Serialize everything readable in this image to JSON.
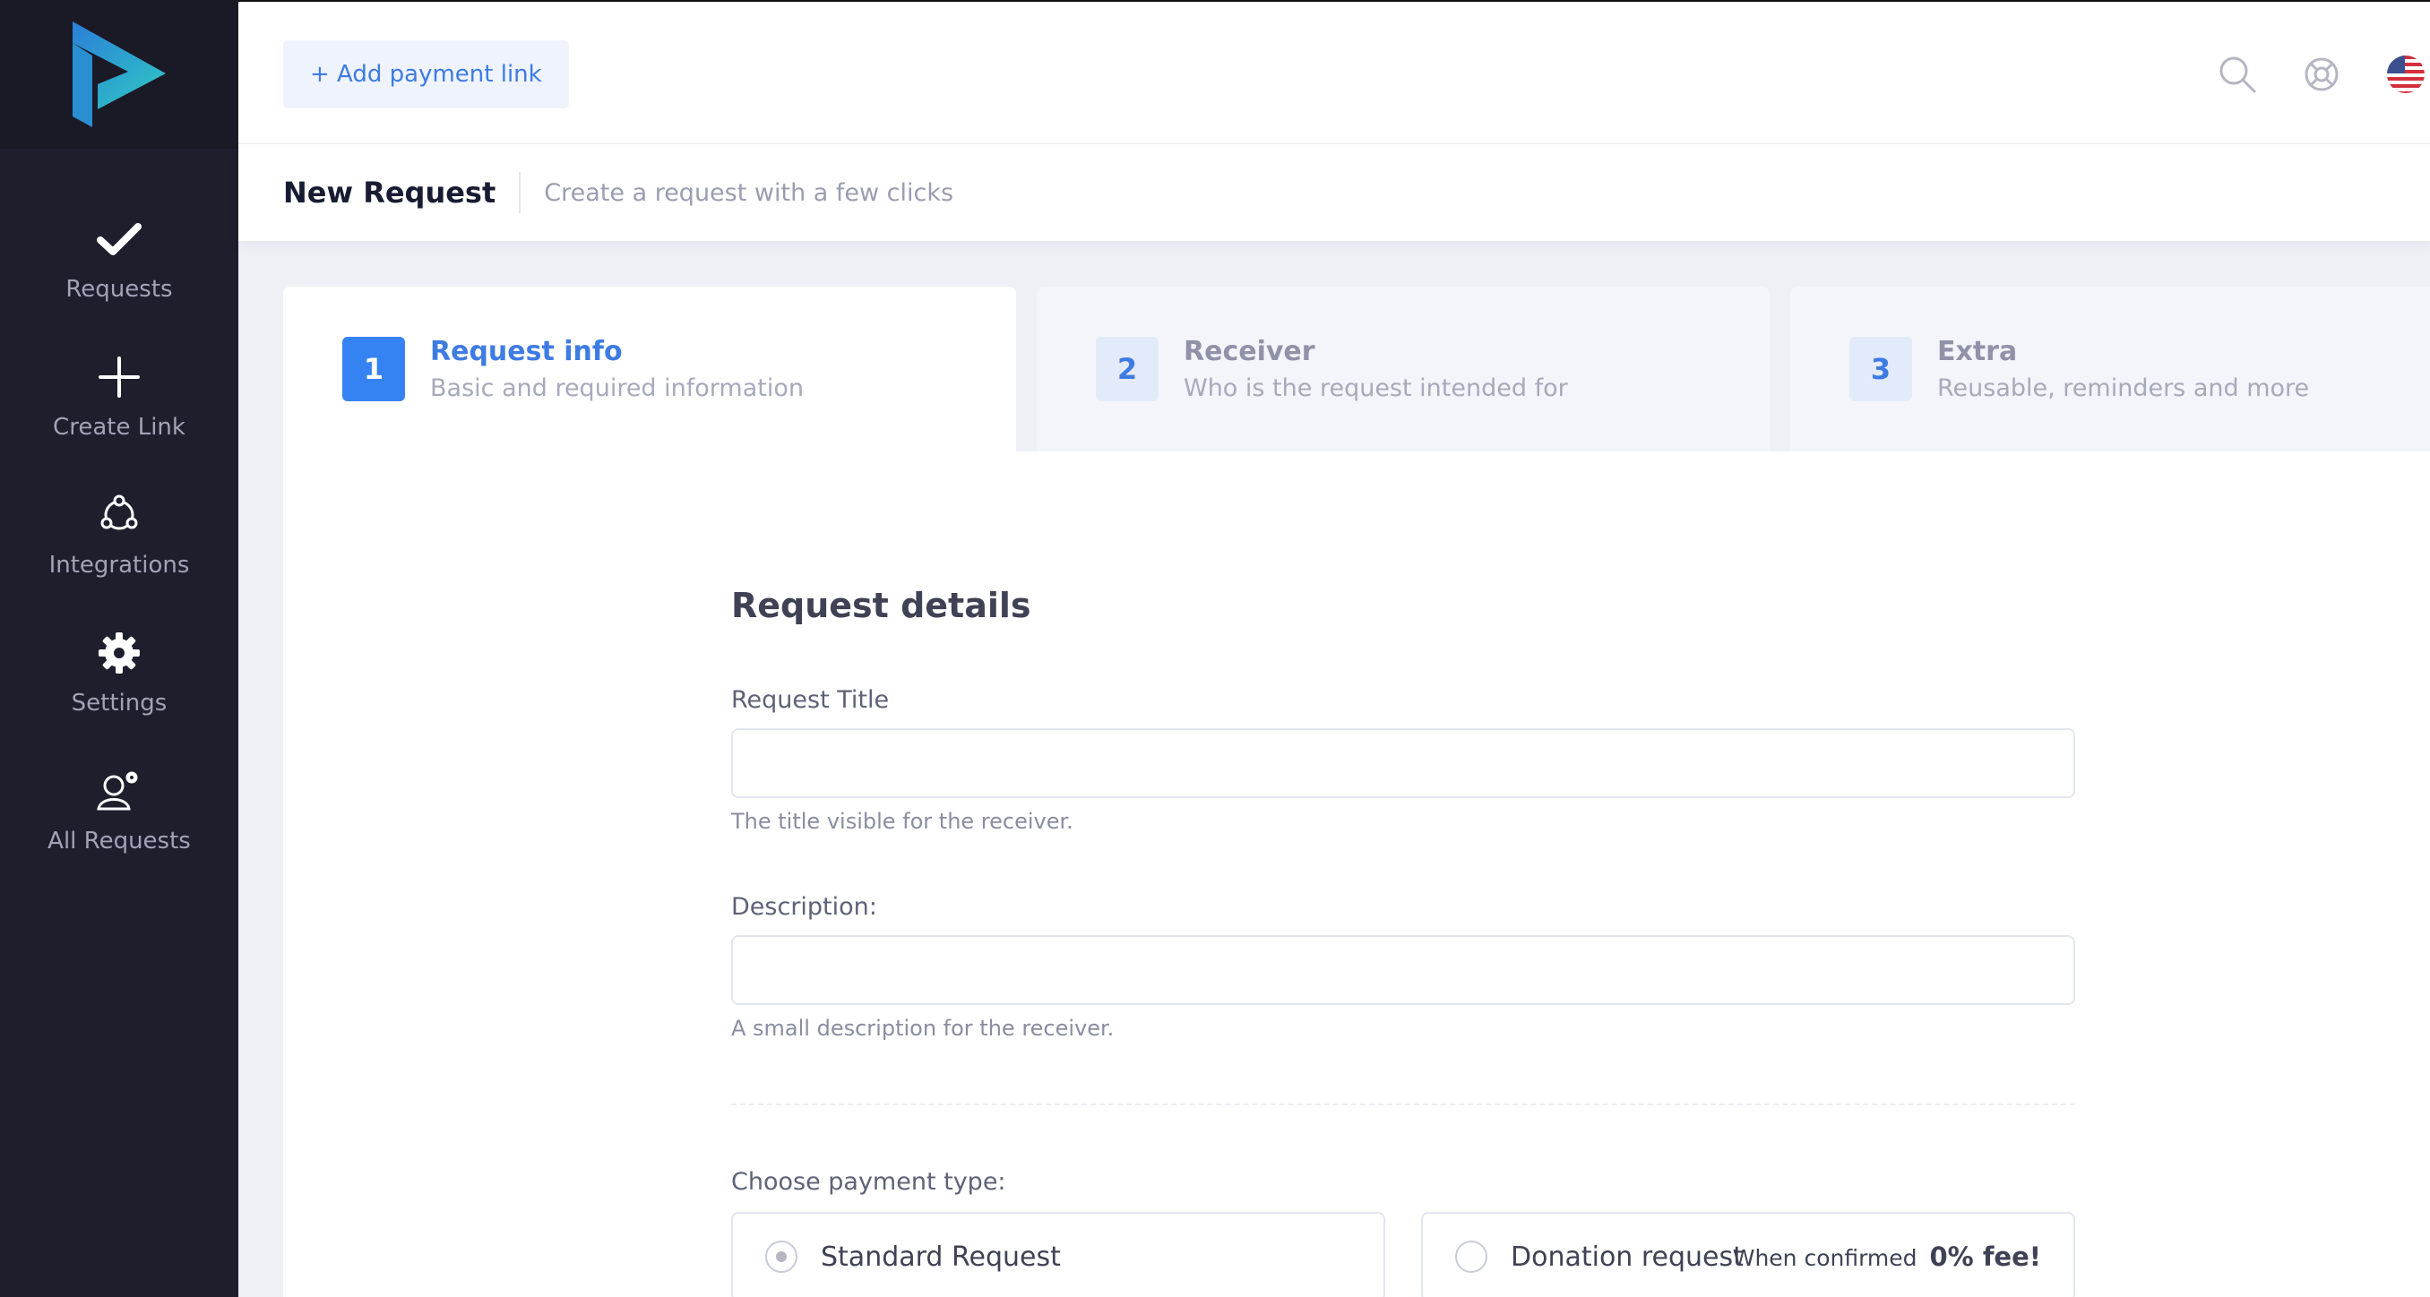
{
  "sidebar": {
    "logo_icon": "brand-logo-icon",
    "items": [
      {
        "label": "Requests",
        "icon": "check-icon"
      },
      {
        "label": "Create Link",
        "icon": "plus-icon"
      },
      {
        "label": "Integrations",
        "icon": "network-icon"
      },
      {
        "label": "Settings",
        "icon": "gear-icon"
      },
      {
        "label": "All Requests",
        "icon": "user-settings-icon"
      }
    ]
  },
  "topbar": {
    "add_button_label": "+ Add payment link",
    "icons": [
      "search-icon",
      "help-lifebuoy-icon",
      "us-flag-icon"
    ]
  },
  "subheader": {
    "title": "New Request",
    "description": "Create a request with a few clicks"
  },
  "wizard": {
    "steps": [
      {
        "number": "1",
        "title": "Request info",
        "subtitle": "Basic and required information",
        "active": true
      },
      {
        "number": "2",
        "title": "Receiver",
        "subtitle": "Who is the request intended for",
        "active": false
      },
      {
        "number": "3",
        "title": "Extra",
        "subtitle": "Reusable, reminders and more",
        "active": false
      }
    ]
  },
  "form": {
    "section_title": "Request details",
    "request_title": {
      "label": "Request Title",
      "value": "",
      "help": "The title visible for the receiver."
    },
    "description": {
      "label": "Description:",
      "value": "",
      "help": "A small description for the receiver."
    },
    "payment_type": {
      "label": "Choose payment type:",
      "options": [
        {
          "label": "Standard Request",
          "selected": true
        },
        {
          "label": "Donation request",
          "selected": false,
          "note_prefix": "When confirmed",
          "note_strong": "0% fee!"
        }
      ]
    }
  },
  "colors": {
    "accent": "#3583f3",
    "sidebar_bg": "#1e1e2d",
    "brand_gradient_start": "#2b7fd8",
    "brand_gradient_end": "#2fc9c4"
  }
}
